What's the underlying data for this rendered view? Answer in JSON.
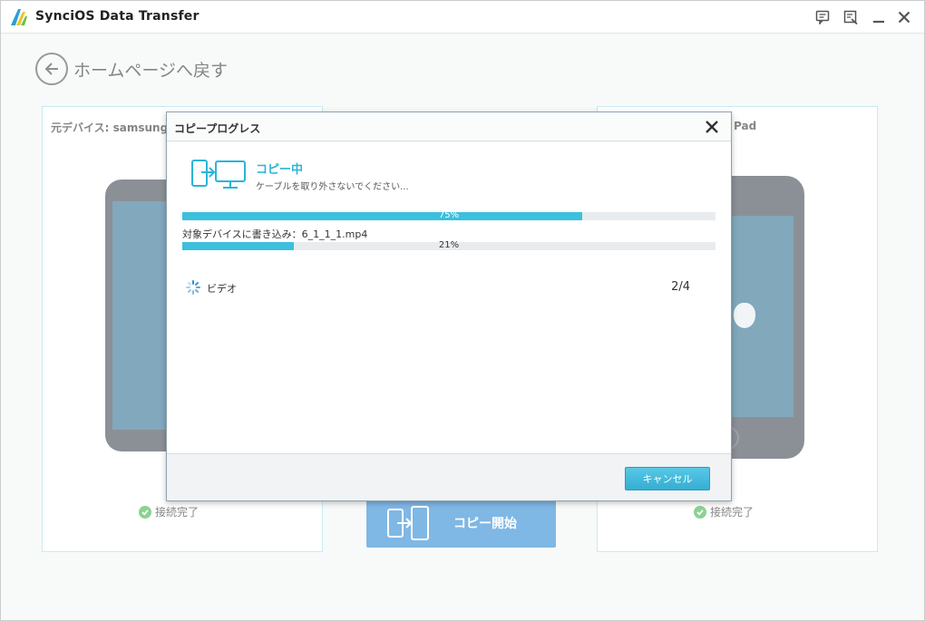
{
  "window": {
    "title": "SynciOS Data Transfer"
  },
  "titlebar": {
    "icons": [
      "feedback-icon",
      "register-icon",
      "minimize-icon",
      "close-icon"
    ]
  },
  "back": {
    "label": "ホームページへ戻す"
  },
  "source_panel": {
    "title": "元デバイス: samsung",
    "status": "接続完了"
  },
  "target_panel": {
    "title": "Pad",
    "status": "接続完了"
  },
  "start_button": {
    "label": "コピー開始"
  },
  "dialog": {
    "title": "コピープログレス",
    "status_title": "コピー中",
    "status_sub": "ケーブルを取り外さないでください...",
    "overall_progress": {
      "value": 0.75,
      "label": "75%"
    },
    "writing_label": "対象デバイスに書き込み：6_1_1_1.mp4",
    "file_progress": {
      "value": 0.21,
      "label": "21%"
    },
    "items": [
      {
        "icon": "loading-spinner-icon",
        "label": "ビデオ",
        "count": "2/4"
      }
    ],
    "cancel_label": "キャンセル"
  },
  "colors": {
    "accent": "#3cc0dd",
    "primary_button": "#2b87d4",
    "connected_check": "#3cb54a"
  }
}
